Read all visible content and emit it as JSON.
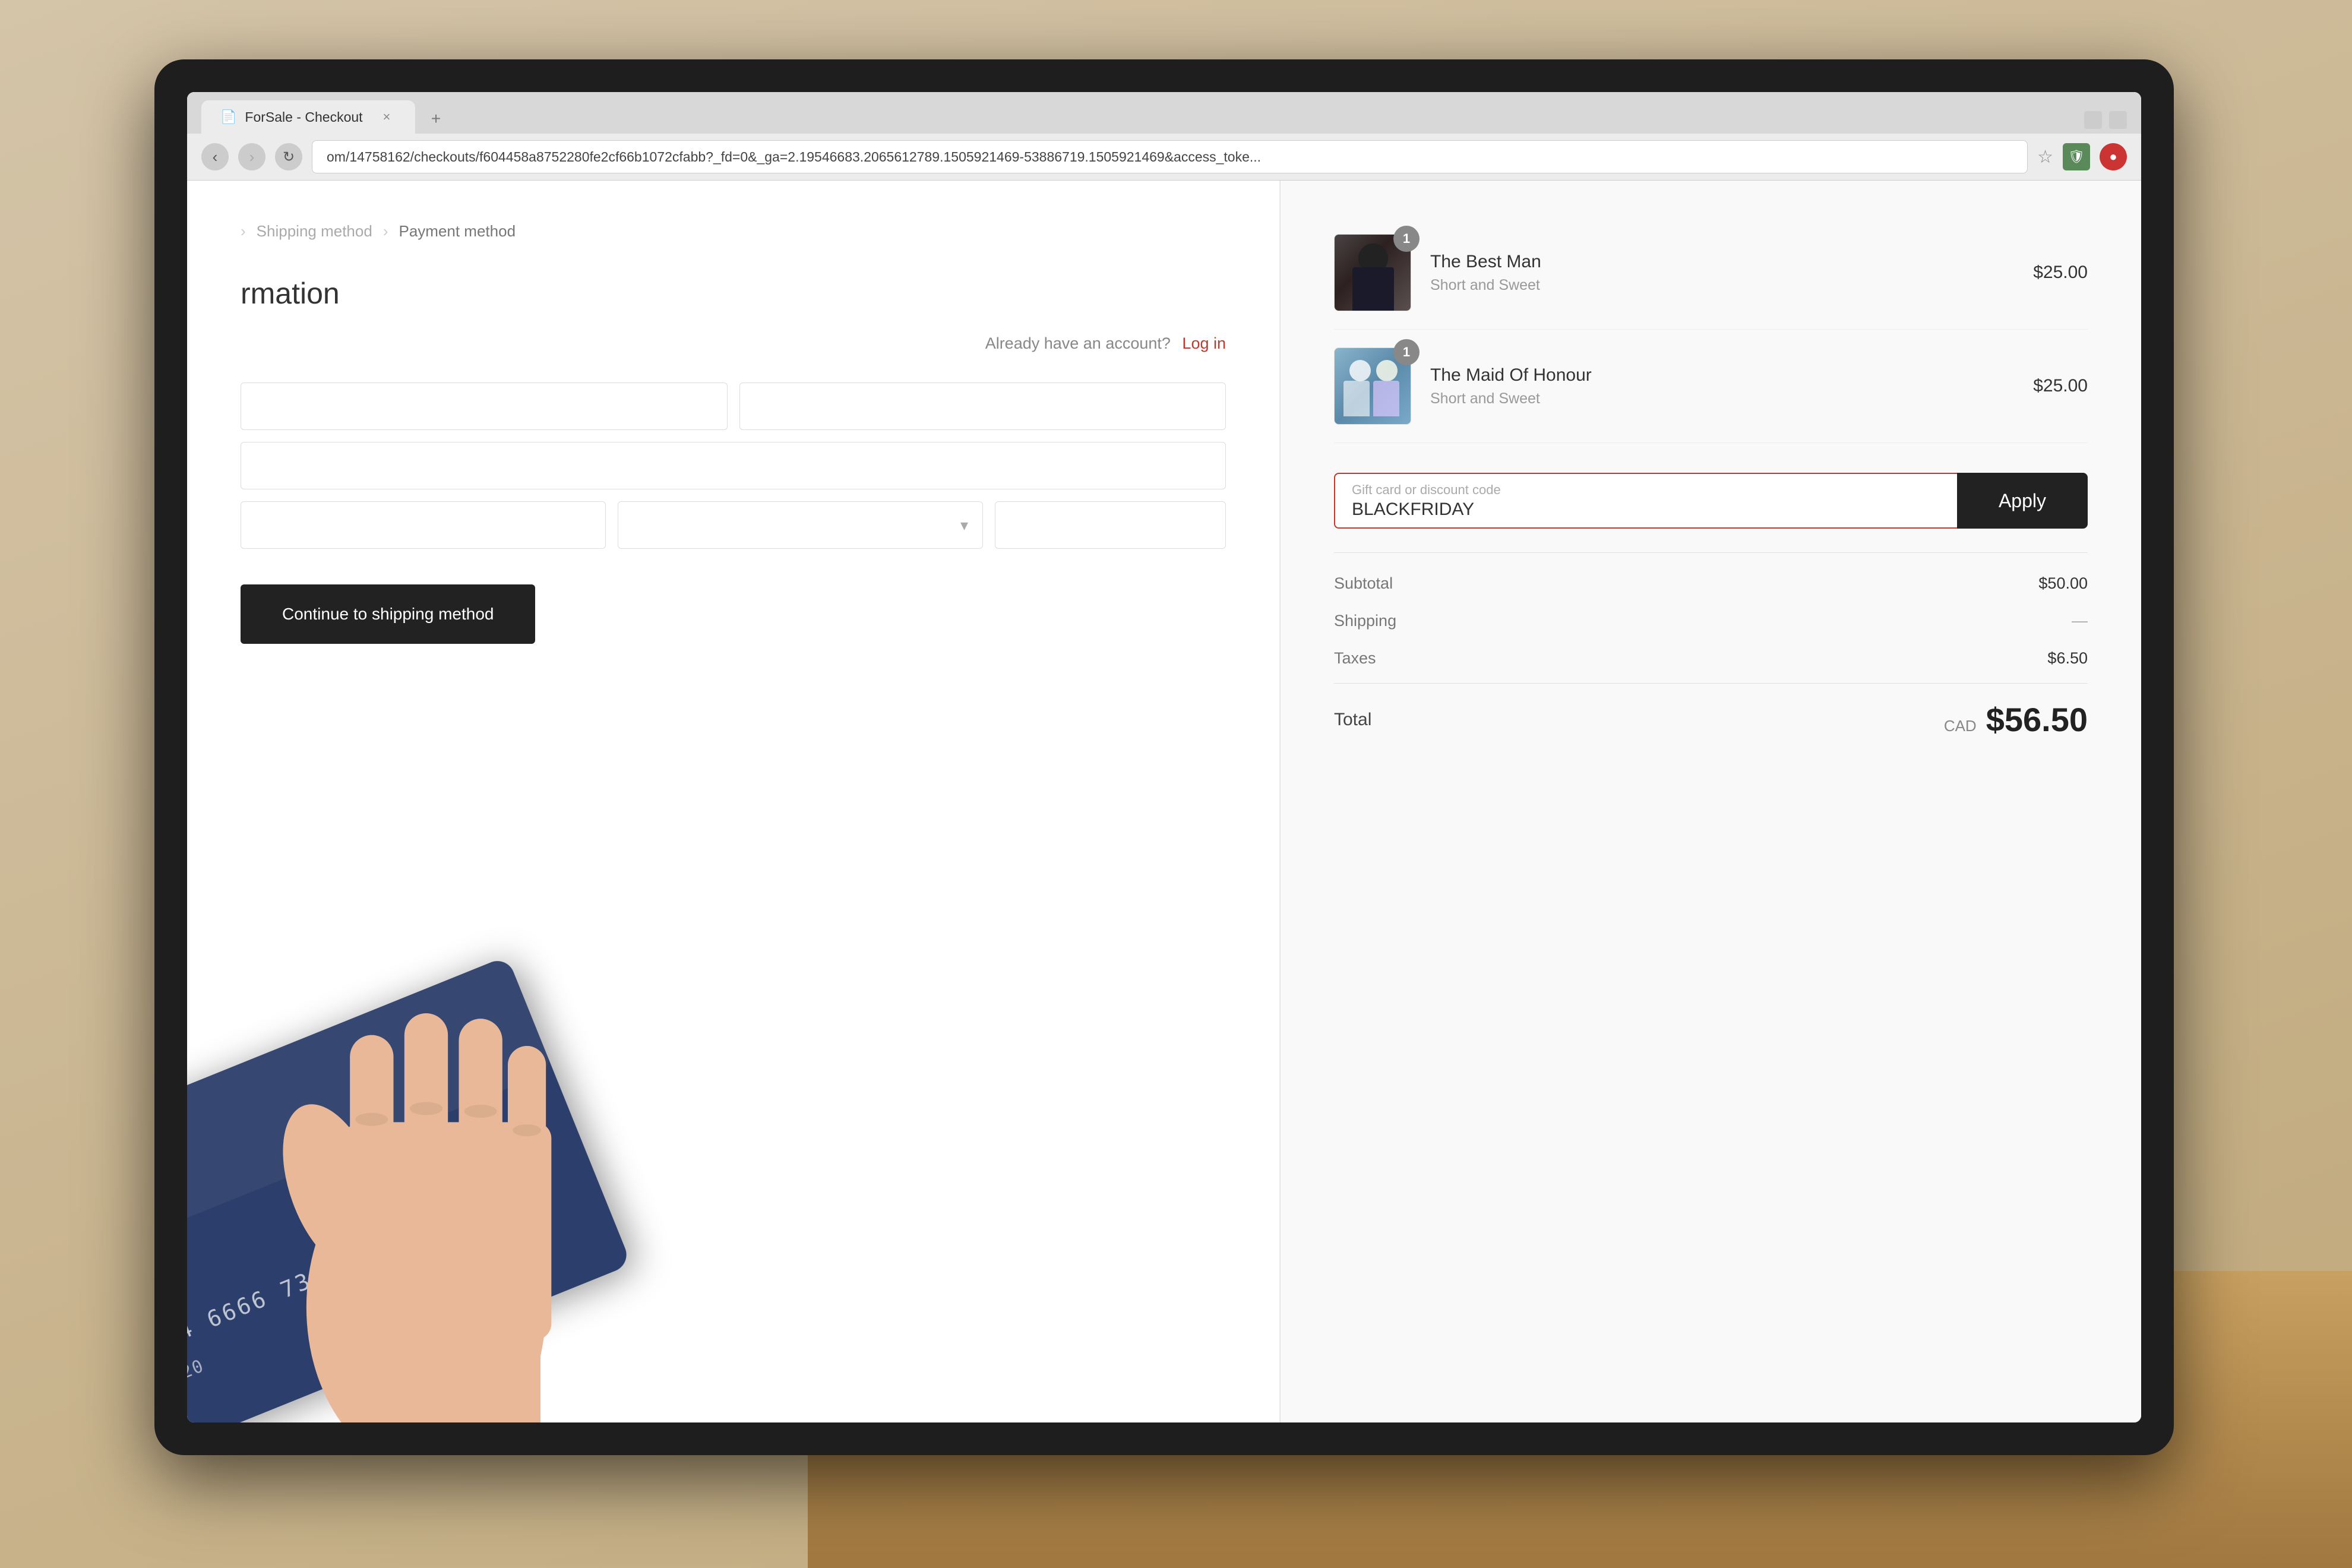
{
  "browser": {
    "tab_title": "ForSale - Checkout",
    "tab_icon": "📄",
    "address_bar": "om/14758162/checkouts/f604458a8752280fe2cf66b1072cfabb?_fd=0&_ga=2.19546683.2065612789.1505921469-53886719.1505921469&access_toke...",
    "close_button": "×",
    "nav_back": "‹",
    "nav_forward": "›",
    "star_icon": "☆",
    "extension1": "🛡",
    "extension2": "⭕"
  },
  "breadcrumb": {
    "step1": ">",
    "step2": "Shipping method",
    "separator": ">",
    "step3": "Payment method"
  },
  "left_panel": {
    "section_title": "rmation",
    "login_prompt": "Already have an account?",
    "login_link": "Log in",
    "continue_button": "Continue to shipping method"
  },
  "right_panel": {
    "items": [
      {
        "name": "The Best Man",
        "subtitle": "Short and Sweet",
        "price": "$25.00",
        "quantity": "1",
        "badge": "1"
      },
      {
        "name": "The Maid Of Honour",
        "subtitle": "Short and Sweet",
        "price": "$25.00",
        "quantity": "1",
        "badge": "1"
      }
    ],
    "discount_placeholder": "Gift card or discount code",
    "discount_value": "BLACKFRIDAY",
    "apply_button": "Apply",
    "summary": {
      "subtotal_label": "Subtotal",
      "subtotal_value": "$50.00",
      "shipping_label": "Shipping",
      "shipping_value": "—",
      "taxes_label": "Taxes",
      "taxes_value": "$6.50",
      "total_label": "Total",
      "total_currency": "CAD",
      "total_amount": "$56.50"
    }
  }
}
